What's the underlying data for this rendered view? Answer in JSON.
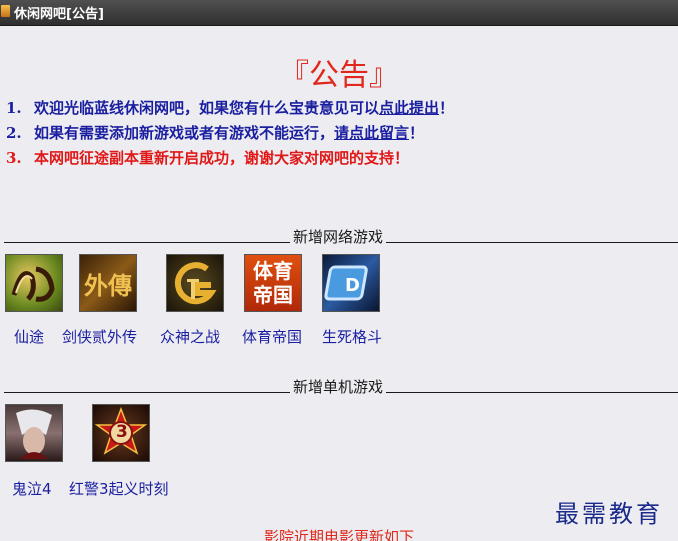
{
  "window": {
    "title": "休闲网吧[公告]"
  },
  "heading": "『公告』",
  "notices": [
    {
      "num": "1.",
      "text": "欢迎光临蓝线休闲网吧，如果您有什么宝贵意见可以",
      "link": "点此提出",
      "end": "！"
    },
    {
      "num": "2.",
      "text": "如果有需要添加新游戏或者有游戏不能运行，",
      "link": "请点此留言",
      "end": "！"
    },
    {
      "num": "3.",
      "text": "本网吧征途副本重新开启成功，谢谢大家对网吧的支持！"
    }
  ],
  "online_section": {
    "title": "新增网络游戏",
    "games": [
      {
        "name": "仙途",
        "icon": "xiantu-icon"
      },
      {
        "name": "剑侠贰外传",
        "icon": "jianxia-icon"
      },
      {
        "name": "众神之战",
        "icon": "zhongshen-icon"
      },
      {
        "name": "体育帝国",
        "icon": "tiyu-icon",
        "icon_text": "体育\n帝国"
      },
      {
        "name": "生死格斗",
        "icon": "shengsi-icon"
      }
    ]
  },
  "single_section": {
    "title": "新增单机游戏",
    "games": [
      {
        "name": "鬼泣4",
        "icon": "devil-may-cry-icon"
      },
      {
        "name": "红警3起义时刻",
        "icon": "red-alert-icon",
        "icon_text": "3"
      }
    ]
  },
  "watermark": "最需教育",
  "footer_text": "影院近期电影更新如下",
  "colors": {
    "accent_red": "#e0281c",
    "link_blue": "#1a1fa0",
    "titlebar": "#3a3a3a"
  }
}
